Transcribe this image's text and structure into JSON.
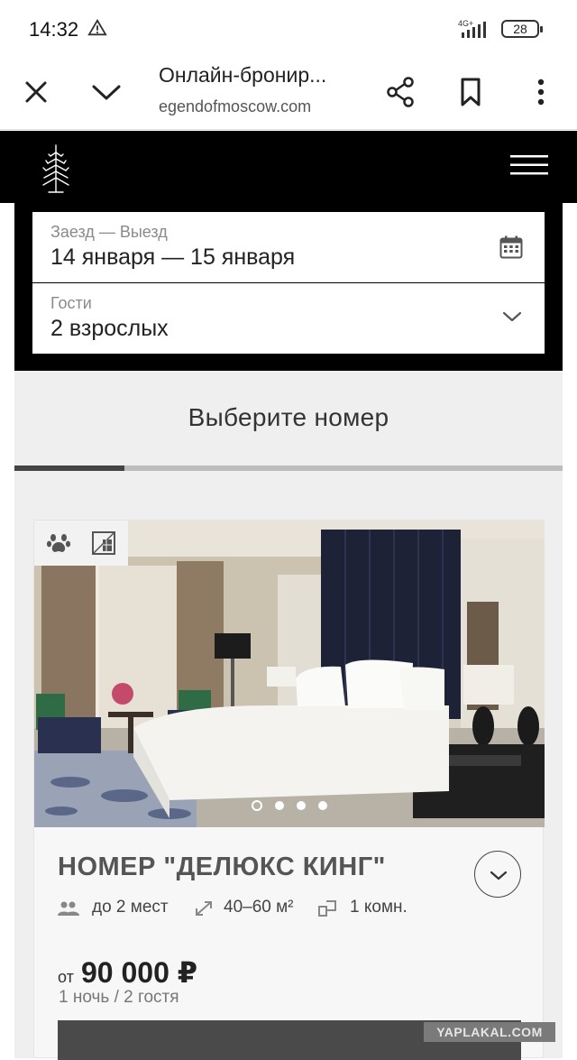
{
  "status": {
    "time": "14:32",
    "network": "4G+",
    "battery": "28"
  },
  "browser": {
    "title": "Онлайн-бронир...",
    "url": "egendofmoscow.com"
  },
  "booking": {
    "dates_label": "Заезд — Выезд",
    "dates_value": "14 января — 15 января",
    "guests_label": "Гости",
    "guests_value": "2 взрослых"
  },
  "section": {
    "title": "Выберите номер",
    "progress": 0.2
  },
  "room": {
    "name": "НОМЕР \"ДЕЛЮКС КИНГ\"",
    "capacity": "до 2 мест",
    "area": "40–60 м²",
    "rooms": "1 комн.",
    "price_prefix": "от",
    "price": "90 000 ₽",
    "price_note": "1 ночь / 2 гостя",
    "photo_count": 4,
    "photo_active": 0
  },
  "watermark": "YAPLAKAL.COM",
  "colors": {
    "header": "#000000",
    "panel": "#efefef",
    "accent_dark": "#4a4a4a"
  }
}
